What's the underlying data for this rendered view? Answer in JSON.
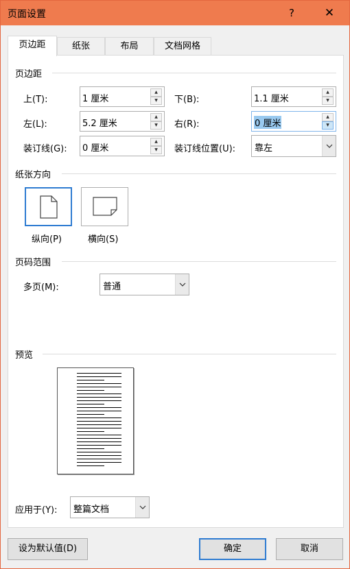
{
  "window": {
    "title": "页面设置",
    "help": "?",
    "close": "✕"
  },
  "tabs": [
    {
      "label": "页边距",
      "active": true
    },
    {
      "label": "纸张",
      "active": false
    },
    {
      "label": "布局",
      "active": false
    },
    {
      "label": "文档网格",
      "active": false
    }
  ],
  "margins": {
    "section_title": "页边距",
    "top": {
      "label": "上(T):",
      "value": "1 厘米"
    },
    "bottom": {
      "label": "下(B):",
      "value": "1.1 厘米"
    },
    "left": {
      "label": "左(L):",
      "value": "5.2 厘米"
    },
    "right": {
      "label": "右(R):",
      "value": "0 厘米",
      "selected": true
    },
    "gutter": {
      "label": "装订线(G):",
      "value": "0 厘米"
    },
    "gutter_position": {
      "label": "装订线位置(U):",
      "value": "靠左"
    }
  },
  "orientation": {
    "section_title": "纸张方向",
    "portrait": {
      "label": "纵向(P)",
      "selected": true,
      "icon": "portrait-page-icon"
    },
    "landscape": {
      "label": "横向(S)",
      "selected": false,
      "icon": "landscape-page-icon"
    }
  },
  "pages": {
    "section_title": "页码范围",
    "multiple": {
      "label": "多页(M):",
      "value": "普通"
    }
  },
  "preview": {
    "section_title": "预览"
  },
  "apply_to": {
    "label": "应用于(Y):",
    "value": "整篇文档"
  },
  "buttons": {
    "set_default": "设为默认值(D)",
    "ok": "确定",
    "cancel": "取消"
  },
  "colors": {
    "titlebar": "#ef7b4e",
    "accent": "#2d7bd1",
    "selection": "#99c9ef"
  }
}
